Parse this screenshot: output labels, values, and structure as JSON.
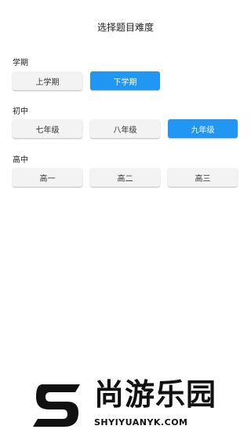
{
  "header": {
    "title": "选择题目难度"
  },
  "sections": [
    {
      "label": "学期",
      "options": [
        "上学期",
        "下学期"
      ],
      "selected_index": 1
    },
    {
      "label": "初中",
      "options": [
        "七年级",
        "八年级",
        "九年级"
      ],
      "selected_index": 2
    },
    {
      "label": "高中",
      "options": [
        "高一",
        "高二",
        "高三"
      ],
      "selected_index": null
    }
  ],
  "colors": {
    "accent": "#2196f3",
    "button_bg": "#f3f3f3",
    "text": "#222222"
  },
  "watermark": {
    "brand": "尚游乐园",
    "url": "SHYIYUANYK.COM"
  }
}
